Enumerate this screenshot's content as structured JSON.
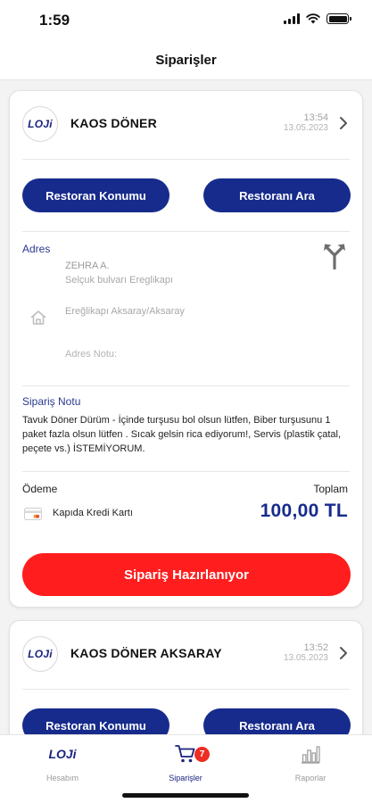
{
  "status_bar": {
    "time": "1:59"
  },
  "nav": {
    "title": "Siparişler"
  },
  "orders": [
    {
      "logo": "LOJi",
      "restaurant": "KAOS DÖNER",
      "time": "13:54",
      "date": "13.05.2023",
      "buttons": {
        "location": "Restoran Konumu",
        "call": "Restoranı Ara"
      },
      "address_label": "Adres",
      "address": {
        "name": "ZEHRA A.",
        "street": "Selçuk bulvarı Ereglikapı",
        "area": "Ereğlikapı Aksaray/Aksaray",
        "note_placeholder": "Adres Notu:"
      },
      "order_note_label": "Sipariş Notu",
      "order_note": "Tavuk Döner Dürüm - İçinde turşusu bol olsun lütfen, Biber turşusunu 1 paket fazla olsun lütfen . Sıcak gelsin rica ediyorum!, Servis (plastik çatal, peçete vs.) İSTEMİYORUM.",
      "payment_label": "Ödeme",
      "payment_method": "Kapıda Kredi Kartı",
      "total_label": "Toplam",
      "total": "100,00 TL",
      "status": "Sipariş Hazırlanıyor"
    },
    {
      "logo": "LOJi",
      "restaurant": "KAOS DÖNER AKSARAY",
      "time": "13:52",
      "date": "13.05.2023",
      "buttons": {
        "location": "Restoran Konumu",
        "call": "Restoranı Ara"
      }
    }
  ],
  "tabs": [
    {
      "label": "Hesabım",
      "logo": "LOJi"
    },
    {
      "label": "Siparişler",
      "icon": "cart-icon",
      "badge": "7"
    },
    {
      "label": "Raporlar",
      "icon": "chart-icon"
    }
  ],
  "colors": {
    "brand_navy": "#172b8c",
    "status_red": "#ff1d1d",
    "badge_red": "#ee2e24"
  }
}
